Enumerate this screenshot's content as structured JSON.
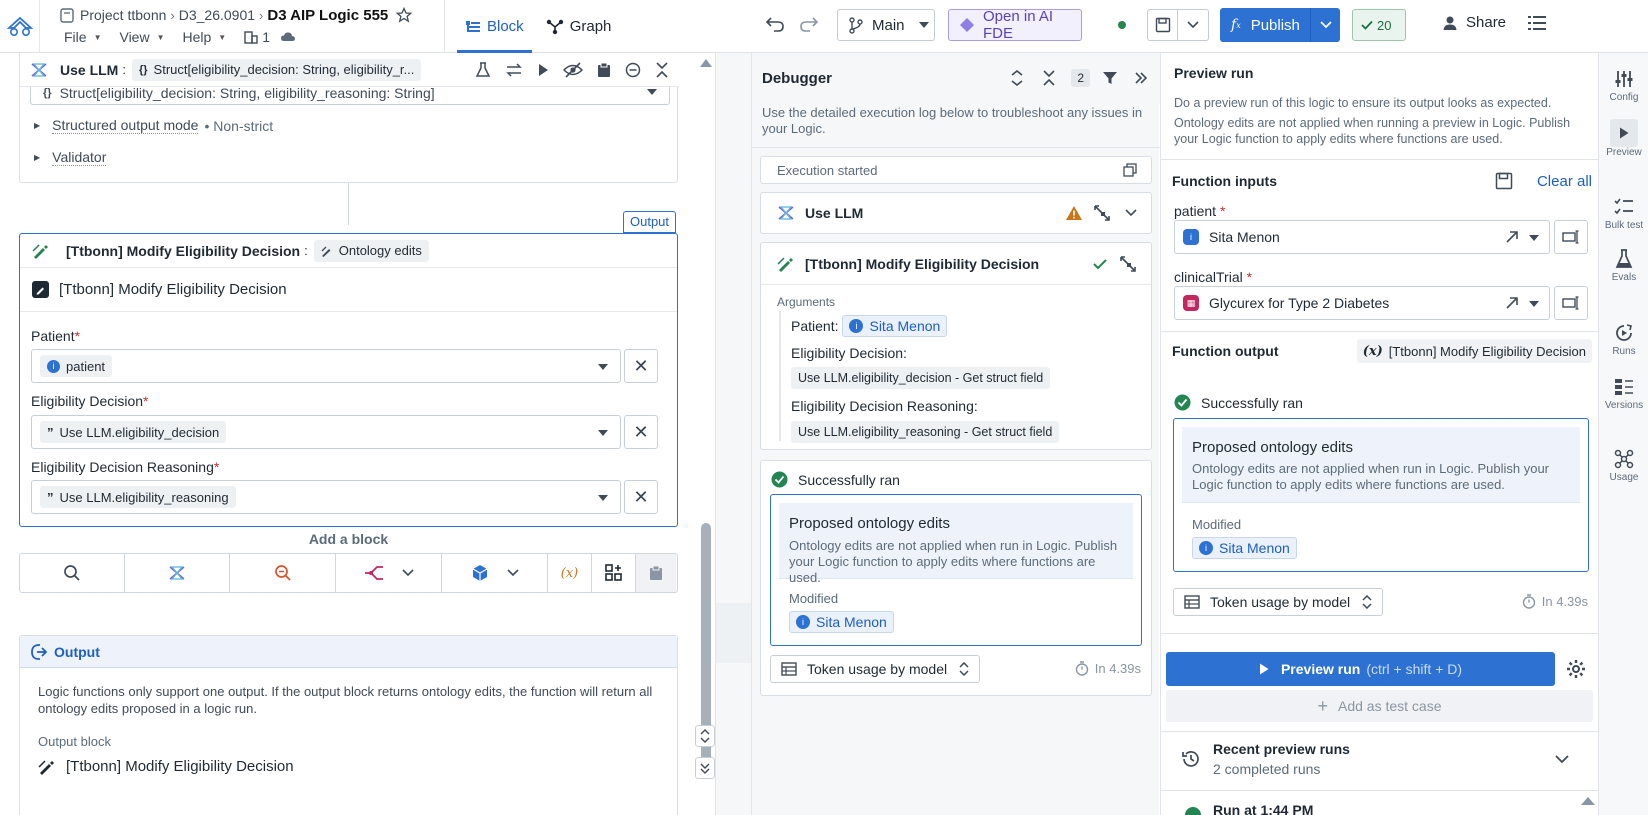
{
  "topbar": {
    "breadcrumb_project": "Project ttbonn",
    "breadcrumb_folder": "D3_26.0901",
    "breadcrumb_current": "D3 AIP Logic 555",
    "menu_file": "File",
    "menu_view": "View",
    "menu_help": "Help",
    "shared_count": "1",
    "tab_block": "Block",
    "tab_graph": "Graph",
    "branch": "Main",
    "open_ai_fde": "Open in AI FDE",
    "publish": "Publish",
    "checks_count": "20",
    "share": "Share"
  },
  "left": {
    "use_llm_title": "Use LLM",
    "use_llm_type": "Struct[eligibility_decision: String, eligibility_r...",
    "struct_row": "Struct[eligibility_decision: String, eligibility_reasoning: String]",
    "structured_output_mode": "Structured output mode",
    "structured_output_value": "• Non-strict",
    "validator": "Validator",
    "output_badge": "Output",
    "block_title": "[Ttbonn] Modify Eligibility Decision",
    "block_type": "Ontology edits",
    "action_name": "[Ttbonn] Modify Eligibility Decision",
    "patient_label": "Patient",
    "patient_value": "patient",
    "eligibility_label": "Eligibility Decision",
    "eligibility_value": "Use LLM.eligibility_decision",
    "reasoning_label": "Eligibility Decision Reasoning",
    "reasoning_value": "Use LLM.eligibility_reasoning",
    "add_block": "Add a block",
    "output_header": "Output",
    "output_desc": "Logic functions only support one output. If the output block returns ontology edits, the function will return all ontology edits proposed in a logic run.",
    "output_block_label": "Output block",
    "output_block_value": "[Ttbonn] Modify Eligibility Decision"
  },
  "debugger": {
    "title": "Debugger",
    "count": "2",
    "desc": "Use the detailed execution log below to troubleshoot any issues in your Logic.",
    "execution_started": "Execution started",
    "use_llm": "Use LLM",
    "modify_title": "[Ttbonn] Modify Eligibility Decision",
    "arguments": "Arguments",
    "patient_label": "Patient:",
    "patient_value": "Sita Menon",
    "eligibility_label": "Eligibility Decision:",
    "eligibility_value": "Use LLM.eligibility_decision - Get struct field",
    "reasoning_label": "Eligibility Decision Reasoning:",
    "reasoning_value": "Use LLM.eligibility_reasoning - Get struct field",
    "success": "Successfully ran",
    "proposed_title": "Proposed ontology edits",
    "proposed_desc": "Ontology edits are not applied when run in Logic. Publish your Logic function to apply edits where functions are used.",
    "modified_label": "Modified",
    "modified_value": "Sita Menon",
    "token_usage": "Token usage by model",
    "duration": "In 4.39s"
  },
  "preview": {
    "title": "Preview run",
    "desc1": "Do a preview run of this logic to ensure its output looks as expected.",
    "desc2": "Ontology edits are not applied when running a preview in Logic. Publish your Logic function to apply edits where functions are used.",
    "function_inputs": "Function inputs",
    "clear_all": "Clear all",
    "patient_label": "patient",
    "patient_value": "Sita Menon",
    "trial_label": "clinicalTrial",
    "trial_value": "Glycurex for Type 2 Diabetes",
    "function_output": "Function output",
    "output_type": "[Ttbonn] Modify Eligibility Decision",
    "success": "Successfully ran",
    "proposed_title": "Proposed ontology edits",
    "proposed_desc": "Ontology edits are not applied when run in Logic. Publish your Logic function to apply edits where functions are used.",
    "modified_label": "Modified",
    "modified_value": "Sita Menon",
    "token_usage": "Token usage by model",
    "duration": "In 4.39s",
    "preview_button": "Preview run",
    "preview_shortcut": "(ctrl + shift + D)",
    "add_test_case": "Add as test case",
    "recent_title": "Recent preview runs",
    "recent_sub": "2 completed runs",
    "run_at": "Run at 1:44 PM"
  },
  "rail": {
    "config": "Config",
    "preview": "Preview",
    "bulk_test": "Bulk test",
    "evals": "Evals",
    "runs": "Runs",
    "versions": "Versions",
    "usage": "Usage"
  },
  "colors": {
    "accent": "#2d72d2",
    "success": "#238551",
    "warning": "#c87619",
    "llm_purple": "#7961db"
  }
}
